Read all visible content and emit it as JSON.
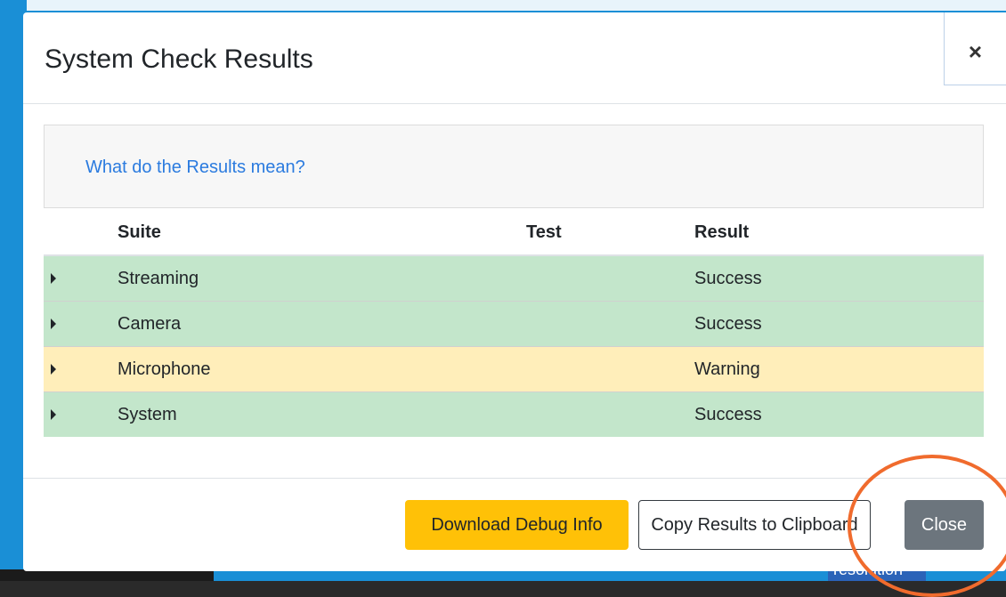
{
  "modal": {
    "title": "System Check Results",
    "close_icon_text": "×",
    "info_link": "What do the Results mean?"
  },
  "table": {
    "headers": {
      "suite": "Suite",
      "test": "Test",
      "result": "Result"
    },
    "rows": [
      {
        "suite": "Streaming",
        "test": "",
        "result": "Success",
        "status": "success"
      },
      {
        "suite": "Camera",
        "test": "",
        "result": "Success",
        "status": "success"
      },
      {
        "suite": "Microphone",
        "test": "",
        "result": "Warning",
        "status": "warning"
      },
      {
        "suite": "System",
        "test": "",
        "result": "Success",
        "status": "success"
      }
    ]
  },
  "footer": {
    "download_label": "Download Debug Info",
    "copy_label": "Copy Results to Clipboard",
    "close_label": "Close"
  },
  "background": {
    "badge_text": "resolution"
  },
  "colors": {
    "success_row": "#c3e6cb",
    "warning_row": "#ffeeba",
    "download_button": "#ffc107",
    "close_button": "#6c757d",
    "link": "#2b7bdf",
    "highlight": "#f06b2d"
  }
}
